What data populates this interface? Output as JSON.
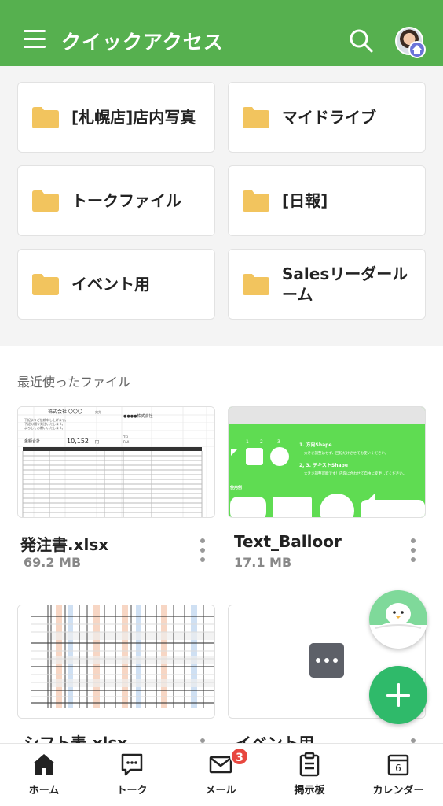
{
  "header": {
    "title": "クイックアクセス"
  },
  "quick_access": {
    "folders": [
      {
        "label": "[札幌店]店内写真"
      },
      {
        "label": "マイドライブ"
      },
      {
        "label": "トークファイル"
      },
      {
        "label": "[日報]"
      },
      {
        "label": "イベント用"
      },
      {
        "label": "Salesリーダールーム"
      }
    ]
  },
  "recent": {
    "title": "最近使ったファイル",
    "files": [
      {
        "name": "発注書.xlsx",
        "size": "69.2 MB"
      },
      {
        "name": "Text_Balloor",
        "size": "17.1 MB"
      },
      {
        "name": "シフト表.xlsx",
        "size": ""
      },
      {
        "name": "イベント用",
        "size": ""
      }
    ],
    "thumb_po": {
      "company": "株式会社 〇〇〇",
      "recipient_label": "宛先",
      "vendor": "●●●●株式会社",
      "intro_1": "下記よりご依頼申し上げます。",
      "intro_2": "下記の通り発注いたします。",
      "intro_3": "よろしくお願いいたします。",
      "total_label": "金額合計",
      "total_value": "10,152",
      "currency": "円",
      "tel": "TEL",
      "fax": "FAX"
    },
    "thumb_balloon": {
      "num_1": "1",
      "num_2": "2",
      "num_3": "3",
      "heading_1": "1. 方向Shape",
      "desc_1": "大きさ調整はせず、回転だけさせてお使いください。",
      "heading_2": "2, 3. テキストShape",
      "desc_2": "大きさ調整可能です！内容に合わせて自由に変更してください。",
      "example_label": "使用例"
    }
  },
  "bottom_nav": [
    {
      "label": "ホーム"
    },
    {
      "label": "トーク"
    },
    {
      "label": "メール",
      "badge": "3"
    },
    {
      "label": "掲示板"
    },
    {
      "label": "カレンダー",
      "day": "6"
    }
  ],
  "colors": {
    "header": "#56b04f",
    "folder": "#f2c45e",
    "fab": "#2fba6a",
    "badge": "#e8473f",
    "balloon_bg": "#5fdc52"
  },
  "icons": [
    "menu-icon",
    "search-icon",
    "folder-icon",
    "more-icon",
    "home-icon",
    "chat-icon",
    "mail-icon",
    "board-icon",
    "calendar-icon",
    "plus-icon"
  ]
}
